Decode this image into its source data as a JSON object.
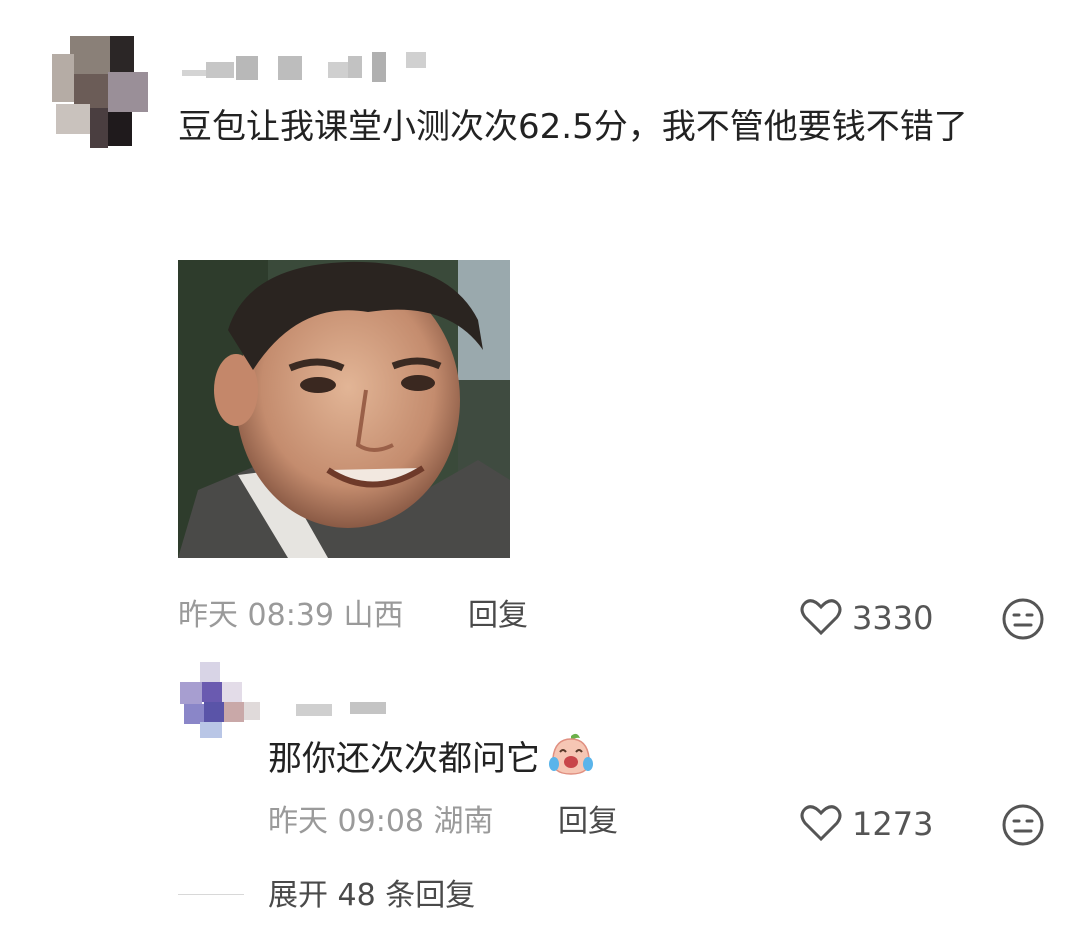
{
  "comment": {
    "text": "豆包让我课堂小测次次62.5分，我不管他要钱不错了",
    "time": "昨天 08:39",
    "location": "山西",
    "reply_label": "回复",
    "likes": "3330"
  },
  "reply": {
    "text": "那你还次次都问它",
    "time": "昨天 09:08",
    "location": "湖南",
    "reply_label": "回复",
    "likes": "1273"
  },
  "expand": {
    "label": "展开 48 条回复"
  },
  "icons": {
    "like": "heart-outline-icon",
    "dislike": "neutral-face-icon",
    "emoji": "crying-laughing-emoji"
  }
}
